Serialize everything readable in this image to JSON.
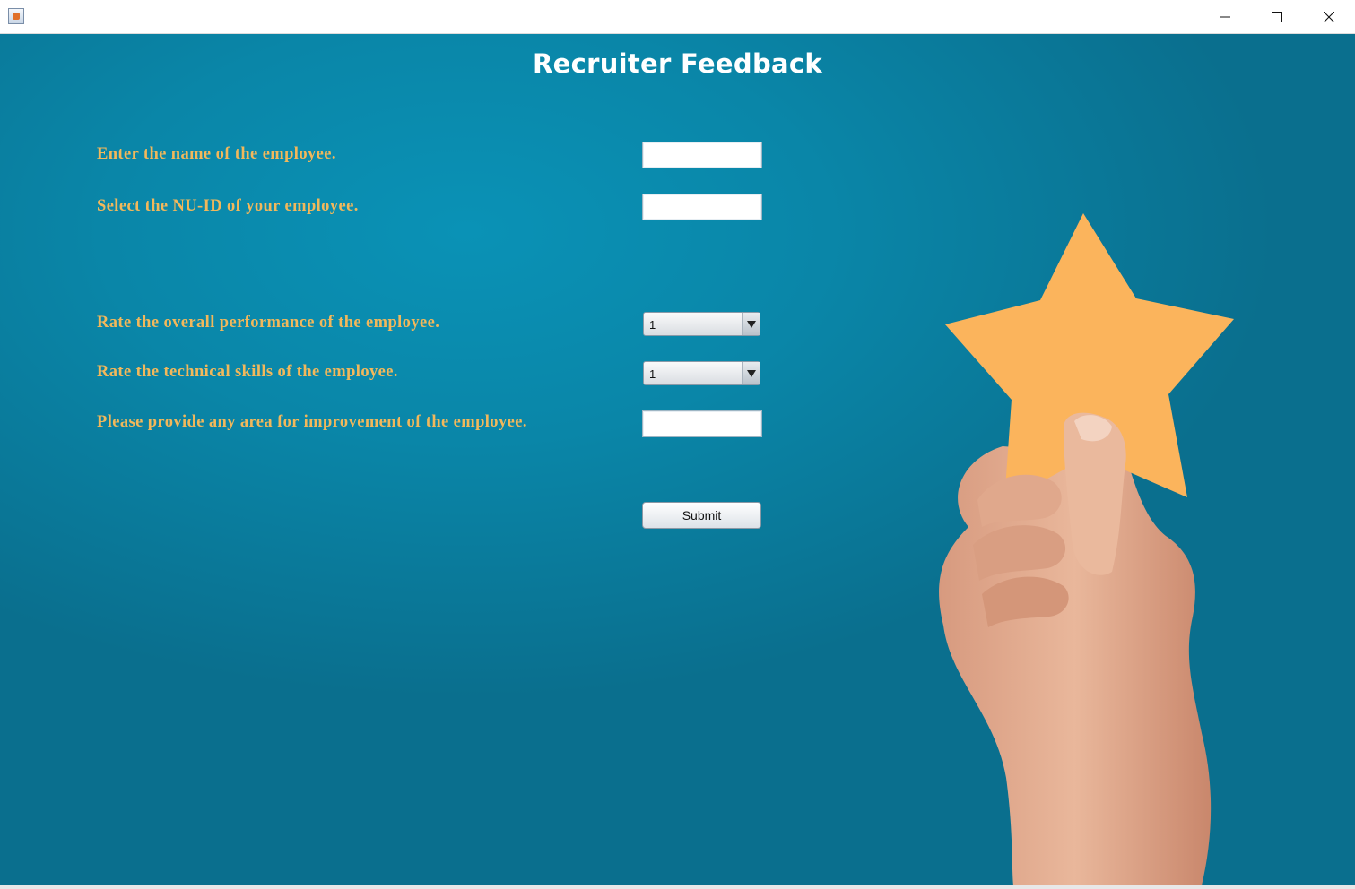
{
  "window": {
    "controls": {
      "minimize_icon": "minimize-icon",
      "maximize_icon": "maximize-icon",
      "close_icon": "close-icon"
    }
  },
  "form": {
    "title": "Recruiter Feedback",
    "name_label": "Enter the name of the employee.",
    "name_value": "",
    "nuid_label": "Select the NU-ID of your employee.",
    "nuid_value": "",
    "performance_label": "Rate the overall performance of the employee.",
    "performance_value": "1",
    "technical_label": "Rate the technical skills of the employee.",
    "technical_value": "1",
    "improvement_label": "Please provide any area for improvement of the employee.",
    "improvement_value": "",
    "submit_label": "Submit"
  },
  "colors": {
    "background": "#0a86a8",
    "label_text": "#f2b85b",
    "title_text": "#ffffff",
    "star": "#fbb45c"
  }
}
